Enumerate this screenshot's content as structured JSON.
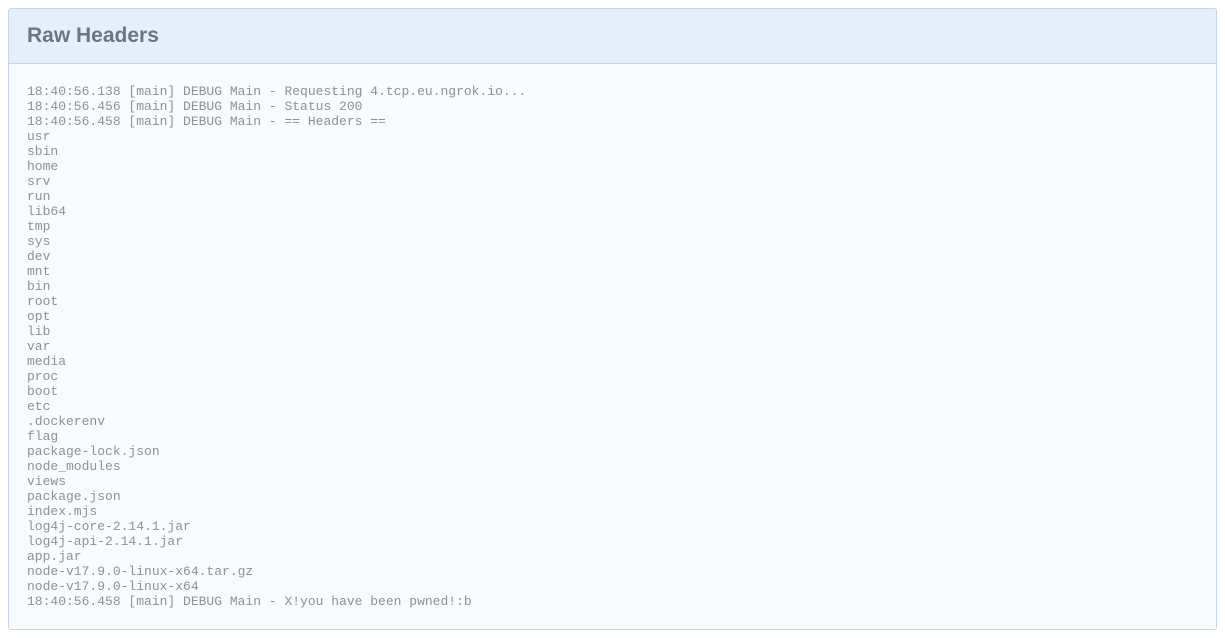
{
  "panel": {
    "title": "Raw Headers"
  },
  "log": {
    "lines": [
      "18:40:56.138 [main] DEBUG Main - Requesting 4.tcp.eu.ngrok.io...",
      "18:40:56.456 [main] DEBUG Main - Status 200",
      "18:40:56.458 [main] DEBUG Main - == Headers ==",
      "usr",
      "sbin",
      "home",
      "srv",
      "run",
      "lib64",
      "tmp",
      "sys",
      "dev",
      "mnt",
      "bin",
      "root",
      "opt",
      "lib",
      "var",
      "media",
      "proc",
      "boot",
      "etc",
      ".dockerenv",
      "flag",
      "package-lock.json",
      "node_modules",
      "views",
      "package.json",
      "index.mjs",
      "log4j-core-2.14.1.jar",
      "log4j-api-2.14.1.jar",
      "app.jar",
      "node-v17.9.0-linux-x64.tar.gz",
      "node-v17.9.0-linux-x64",
      "18:40:56.458 [main] DEBUG Main - X!you have been pwned!:b"
    ]
  }
}
